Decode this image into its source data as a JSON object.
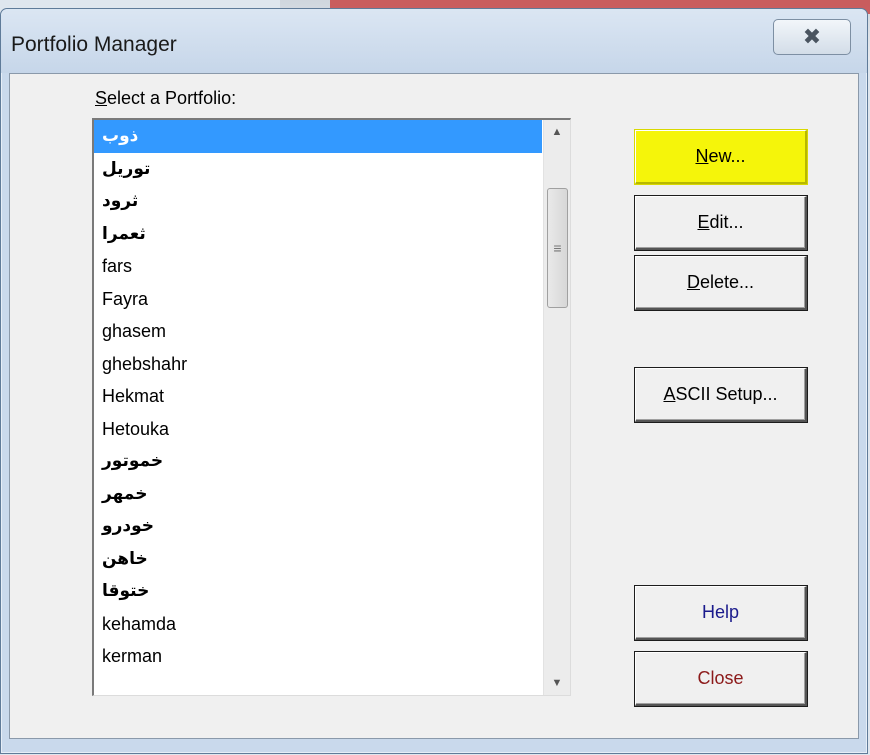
{
  "window": {
    "title": "Portfolio Manager",
    "close_glyph": "✖"
  },
  "list": {
    "label": "Select a Portfolio:",
    "items": [
      {
        "text": "ذوب",
        "arabic": true,
        "selected": true
      },
      {
        "text": "توریل",
        "arabic": true
      },
      {
        "text": "ثرود",
        "arabic": true
      },
      {
        "text": "ثعمرا",
        "arabic": true
      },
      {
        "text": "fars"
      },
      {
        "text": "Fayra"
      },
      {
        "text": "ghasem"
      },
      {
        "text": "ghebshahr"
      },
      {
        "text": "Hekmat"
      },
      {
        "text": "Hetouka"
      },
      {
        "text": "خموتور",
        "arabic": true
      },
      {
        "text": "خمهر",
        "arabic": true
      },
      {
        "text": "خودرو",
        "arabic": true
      },
      {
        "text": "خاهن",
        "arabic": true
      },
      {
        "text": "ختوقا",
        "arabic": true
      },
      {
        "text": "kehamda"
      },
      {
        "text": "kerman"
      }
    ]
  },
  "buttons": {
    "new": "New...",
    "edit": "Edit...",
    "delete": "Delete...",
    "ascii_setup": "ASCII Setup...",
    "help": "Help",
    "close": "Close"
  },
  "colors": {
    "selection": "#3399ff",
    "highlight": "#f5f50a"
  }
}
